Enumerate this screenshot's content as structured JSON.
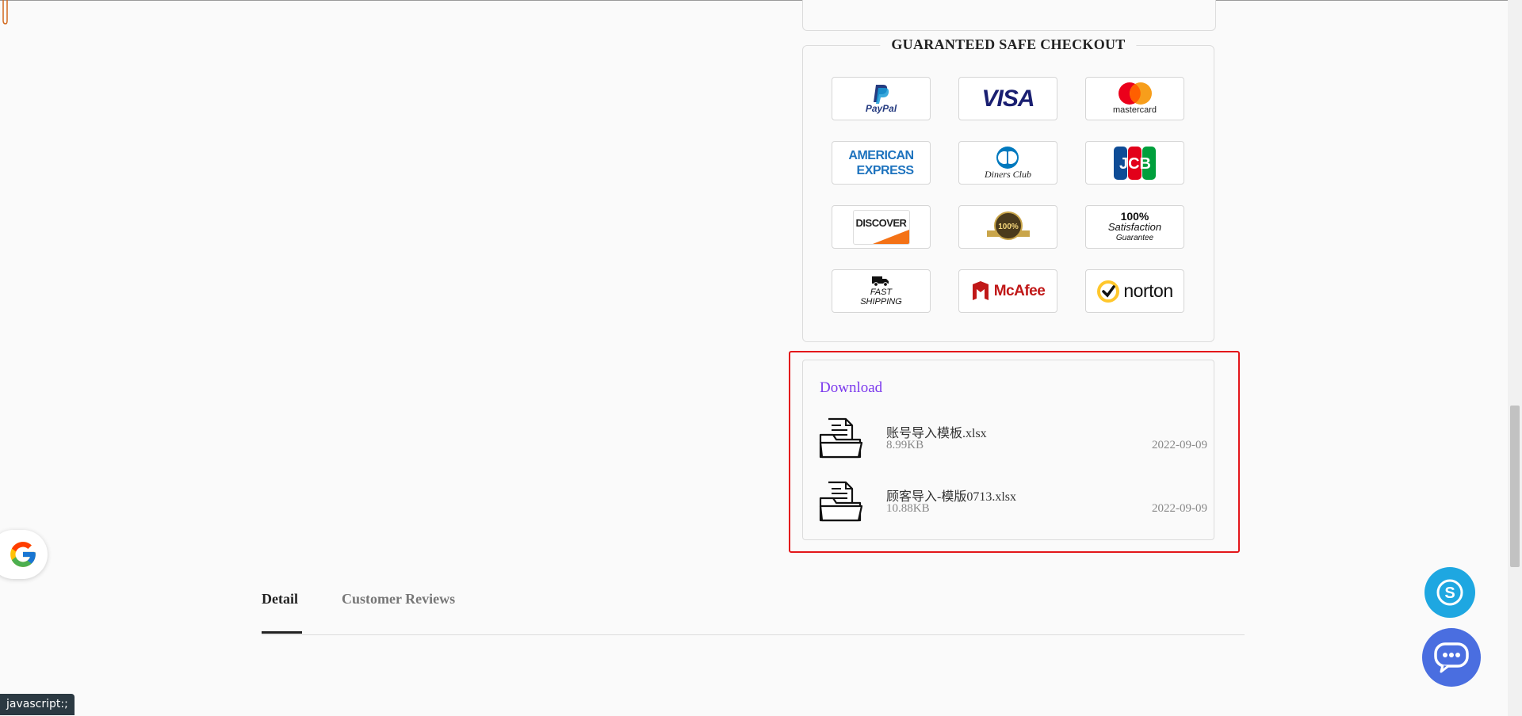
{
  "checkout": {
    "title": "GUARANTEED SAFE CHECKOUT",
    "badges": {
      "paypal": "PayPal",
      "visa": "VISA",
      "mastercard": "mastercard",
      "amex_line1": "AMERICAN",
      "amex_line2": "EXPRESS",
      "diners": "Diners Club",
      "jcb": "JCB",
      "discover": "DISCOVER",
      "guarantee_seal": "100%",
      "satisfaction_line1": "100%",
      "satisfaction_line2": "Satisfaction",
      "satisfaction_line3": "Guarantee",
      "shipping_line1": "FAST",
      "shipping_line2": "SHIPPING",
      "mcafee": "McAfee",
      "norton": "norton"
    }
  },
  "download": {
    "title": "Download",
    "files": [
      {
        "name": "账号导入模板.xlsx",
        "size": "8.99KB",
        "date": "2022-09-09"
      },
      {
        "name": "顾客导入-模版0713.xlsx",
        "size": "10.88KB",
        "date": "2022-09-09"
      }
    ]
  },
  "tabs": {
    "detail": "Detail",
    "reviews": "Customer Reviews"
  },
  "status_bar": {
    "text": "javascript:;"
  },
  "colors": {
    "accent": "#7c3aed",
    "highlight": "#e3161a",
    "skype": "#1ea7e1",
    "chat": "#4a6ee0"
  },
  "icons": {
    "google": "google-icon",
    "skype": "skype-icon",
    "chat": "chat-icon",
    "file": "folder-document-icon"
  }
}
